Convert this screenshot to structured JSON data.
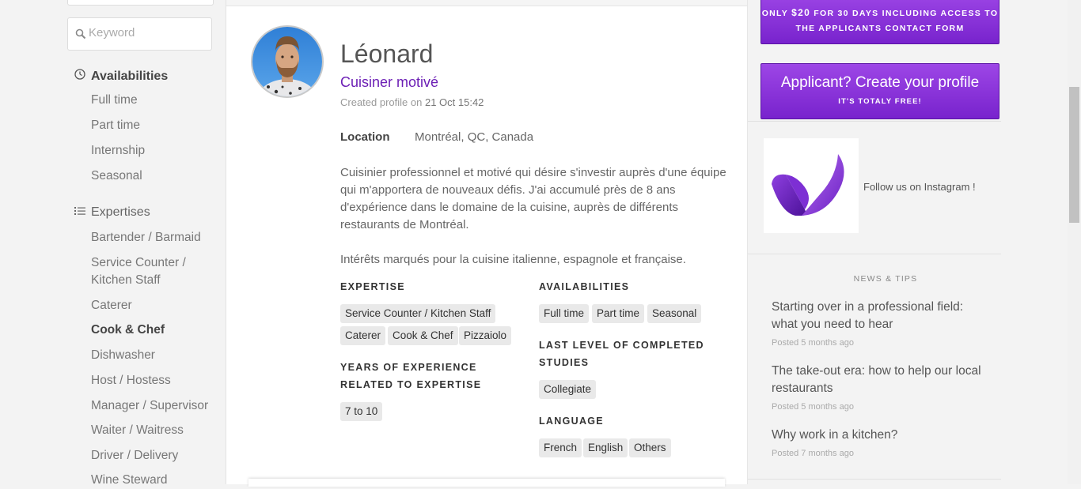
{
  "sidebar": {
    "search_placeholder": "Keyword",
    "availabilities": {
      "label": "Availabilities",
      "items": [
        "Full time",
        "Part time",
        "Internship",
        "Seasonal"
      ]
    },
    "expertises": {
      "label": "Expertises",
      "items": [
        "Bartender / Barmaid",
        "Service Counter / Kitchen Staff",
        "Caterer",
        "Cook & Chef",
        "Dishwasher",
        "Host / Hostess",
        "Manager / Supervisor",
        "Waiter / Waitress",
        "Driver / Delivery",
        "Wine Steward"
      ],
      "active": "Cook & Chef"
    }
  },
  "profile": {
    "name": "Léonard",
    "tagline": "Cuisiner motivé",
    "created_prefix": "Created profile on",
    "created_date": "21 Oct 15:42",
    "location_label": "Location",
    "location_value": "Montréal, QC, Canada",
    "description_p1": "Cuisinier professionnel et motivé qui désire s'investir auprès d'une équipe qui m'apportera de nouveaux défis. J'ai accumulé près de 8 ans d'expérience dans le domaine de la cuisine, auprès de différents restaurants de Montréal.",
    "description_p2": "Intérêts marqués pour la cuisine italienne, espagnole et française.",
    "expertise_title": "EXPERTISE",
    "expertise_tags": [
      "Service Counter / Kitchen Staff",
      "Caterer",
      "Cook & Chef",
      "Pizzaiolo"
    ],
    "years_title": "YEARS OF EXPERIENCE RELATED TO EXPERTISE",
    "years_tag": "7 to 10",
    "availabilities_title": "AVAILABILITIES",
    "availabilities_tags": [
      "Full time",
      "Part time",
      "Seasonal"
    ],
    "studies_title": "LAST LEVEL OF COMPLETED STUDIES",
    "studies_tag": "Collegiate",
    "language_title": "LANGUAGE",
    "language_tags": [
      "French",
      "English",
      "Others"
    ]
  },
  "right": {
    "promo1_line1_pre": "ONLY ",
    "promo1_price": "$20",
    "promo1_line1_post": " FOR 30 DAYS INCLUDING ACCESS TO",
    "promo1_line2": "THE APPLICANTS CONTACT FORM",
    "promo2_title": "Applicant? Create your profile",
    "promo2_sub": "IT'S TOTALY FREE!",
    "instagram_text": "Follow us on Instagram !",
    "news_heading": "NEWS & TIPS",
    "news": [
      {
        "title": "Starting over in a professional field: what you need to hear",
        "date": "Posted 5 months ago"
      },
      {
        "title": "The take-out era: how to help our local restaurants",
        "date": "Posted 5 months ago"
      },
      {
        "title": "Why work in a kitchen?",
        "date": "Posted 7 months ago"
      }
    ]
  },
  "colors": {
    "accent": "#6c1fb5",
    "promo_gradient_top": "#9d46e6",
    "promo_gradient_bottom": "#7823cd"
  }
}
